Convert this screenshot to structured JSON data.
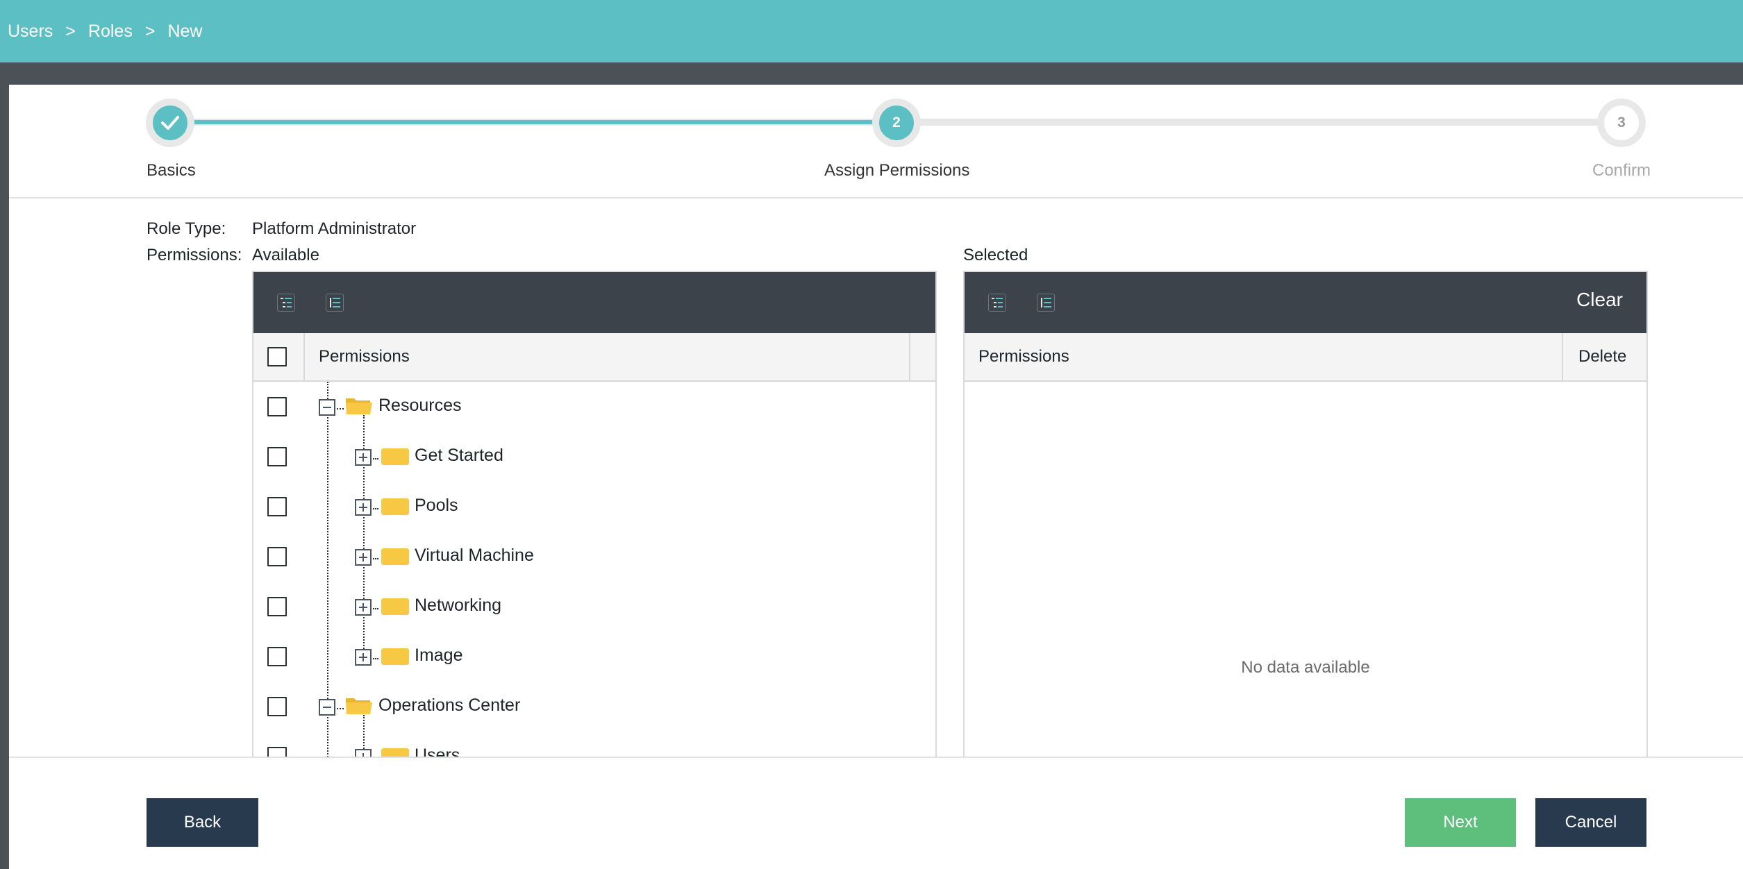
{
  "breadcrumb": [
    {
      "label": "Users"
    },
    {
      "label": "Roles"
    },
    {
      "label": "New"
    }
  ],
  "breadcrumb_separator": ">",
  "stepper": {
    "steps": [
      {
        "label": "Basics",
        "number": "",
        "state": "done"
      },
      {
        "label": "Assign Permissions",
        "number": "2",
        "state": "active"
      },
      {
        "label": "Confirm",
        "number": "3",
        "state": "todo"
      }
    ]
  },
  "form": {
    "role_type_label": "Role Type:",
    "role_type_value": "Platform Administrator",
    "permissions_label": "Permissions:"
  },
  "available": {
    "title": "Available",
    "header_permissions": "Permissions",
    "tree": [
      {
        "label": "Resources",
        "level": 0,
        "expanded": true
      },
      {
        "label": "Get Started",
        "level": 1,
        "expanded": false
      },
      {
        "label": "Pools",
        "level": 1,
        "expanded": false
      },
      {
        "label": "Virtual Machine",
        "level": 1,
        "expanded": false
      },
      {
        "label": "Networking",
        "level": 1,
        "expanded": false
      },
      {
        "label": "Image",
        "level": 1,
        "expanded": false
      },
      {
        "label": "Operations Center",
        "level": 0,
        "expanded": true
      },
      {
        "label": "Users",
        "level": 1,
        "expanded": false
      }
    ]
  },
  "selected": {
    "title": "Selected",
    "clear_label": "Clear",
    "header_permissions": "Permissions",
    "header_delete": "Delete",
    "empty_text": "No data available"
  },
  "footer": {
    "back_label": "Back",
    "next_label": "Next",
    "cancel_label": "Cancel"
  },
  "colors": {
    "accent": "#5bbfc4",
    "toolbar": "#3c434a",
    "button_dark": "#283a4e",
    "button_green": "#5ebf7c",
    "folder": "#f7c843"
  }
}
